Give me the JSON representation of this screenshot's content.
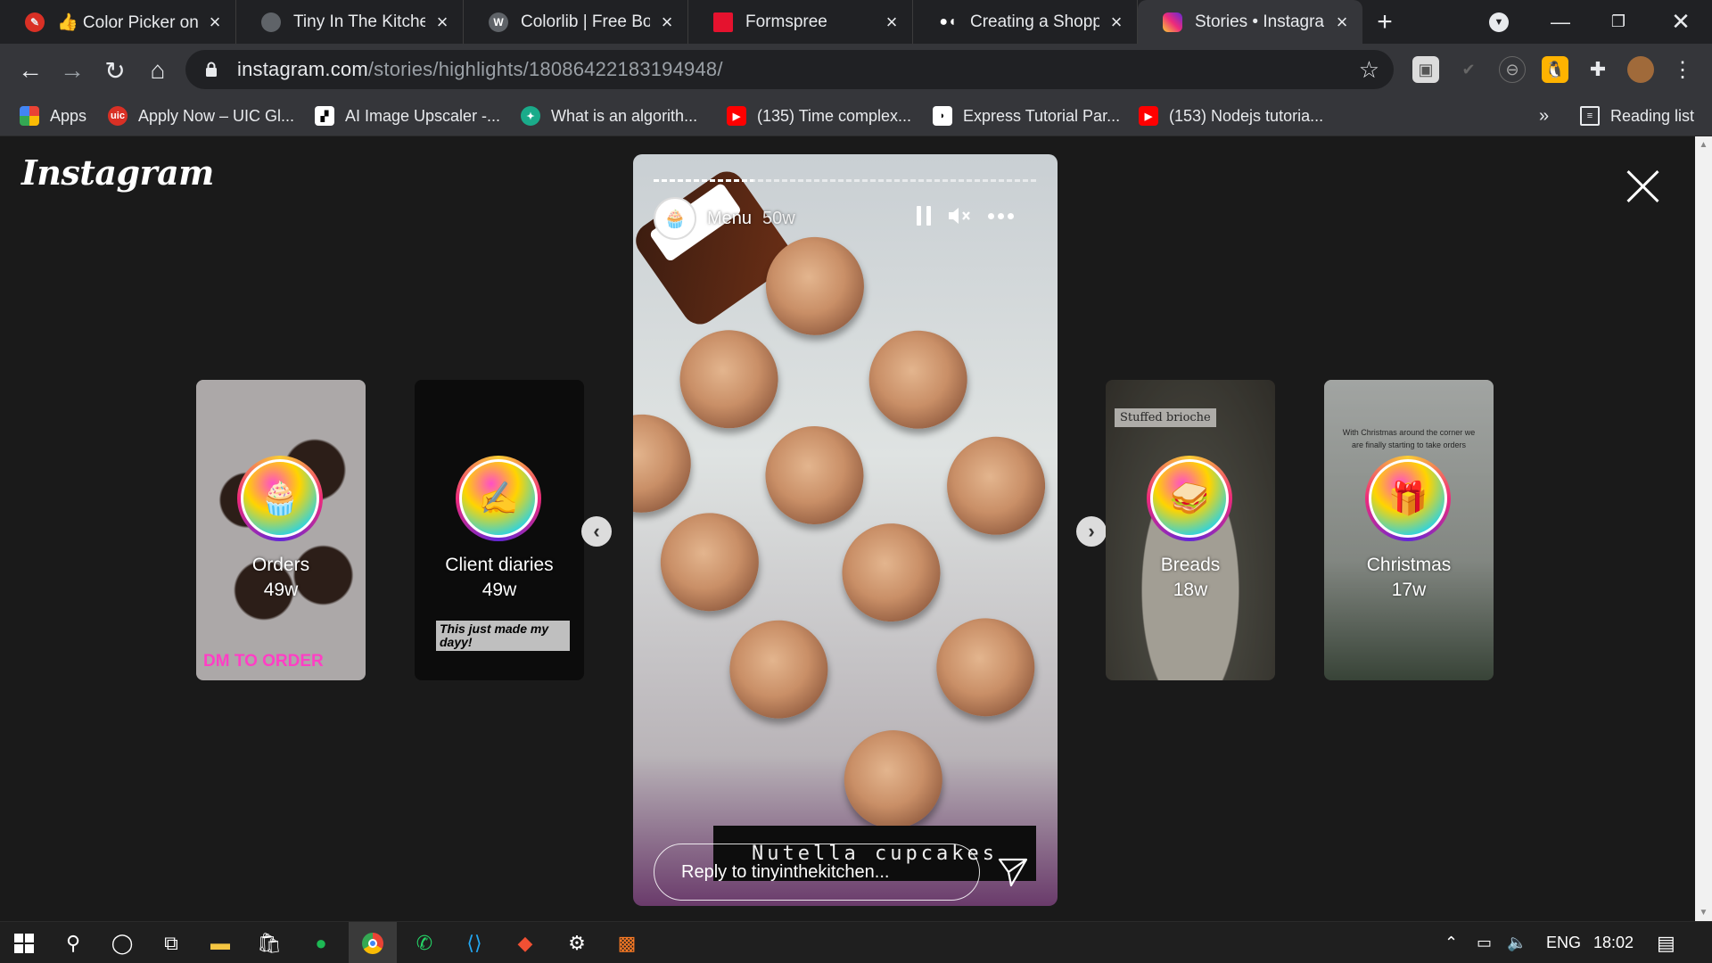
{
  "browser": {
    "tabs": [
      {
        "title": "👍 Color Picker onli",
        "favicon_color": "#d93025"
      },
      {
        "title": "Tiny In The Kitchen",
        "favicon_color": "#5f6368"
      },
      {
        "title": "Colorlib | Free Boots",
        "favicon_color": "#5f6368"
      },
      {
        "title": "Formspree",
        "favicon_color": "#e5122e"
      },
      {
        "title": "Creating a Shoppin",
        "favicon_color": "#ffffff"
      },
      {
        "title": "Stories • Instagram",
        "favicon_color": "#e1306c"
      }
    ],
    "url_domain": "instagram.com",
    "url_path": "/stories/highlights/18086422183194948/",
    "bookmarks": [
      {
        "label": "Apps"
      },
      {
        "label": "Apply Now – UIC Gl..."
      },
      {
        "label": "AI Image Upscaler -..."
      },
      {
        "label": "What is an algorith..."
      },
      {
        "label": "(135) Time complex..."
      },
      {
        "label": "Express Tutorial Par..."
      },
      {
        "label": "(153) Nodejs tutoria..."
      }
    ],
    "bookmarks_more": "»",
    "reading_list": "Reading list"
  },
  "instagram": {
    "logo": "Instagram",
    "main_story": {
      "name": "Menu",
      "age": "50w",
      "caption": "Nutella cupcakes",
      "reply_placeholder": "Reply to tinyinthekitchen...",
      "progress": 0.26
    },
    "highlights_left": [
      {
        "name": "Orders",
        "age": "49w",
        "overlay": "DM TO ORDER"
      },
      {
        "name": "Client diaries",
        "age": "49w",
        "overlay": "This just made my dayy!"
      }
    ],
    "highlights_right": [
      {
        "name": "Breads",
        "age": "18w",
        "overlay": "Stuffed brioche"
      },
      {
        "name": "Christmas",
        "age": "17w",
        "overlay": "With Christmas around the corner we are finally starting to take orders"
      }
    ]
  },
  "taskbar": {
    "language": "ENG",
    "time": "18:02"
  },
  "colors": {
    "accent_pink": "#ee2a7b",
    "dm_text": "#ff3fc5"
  }
}
